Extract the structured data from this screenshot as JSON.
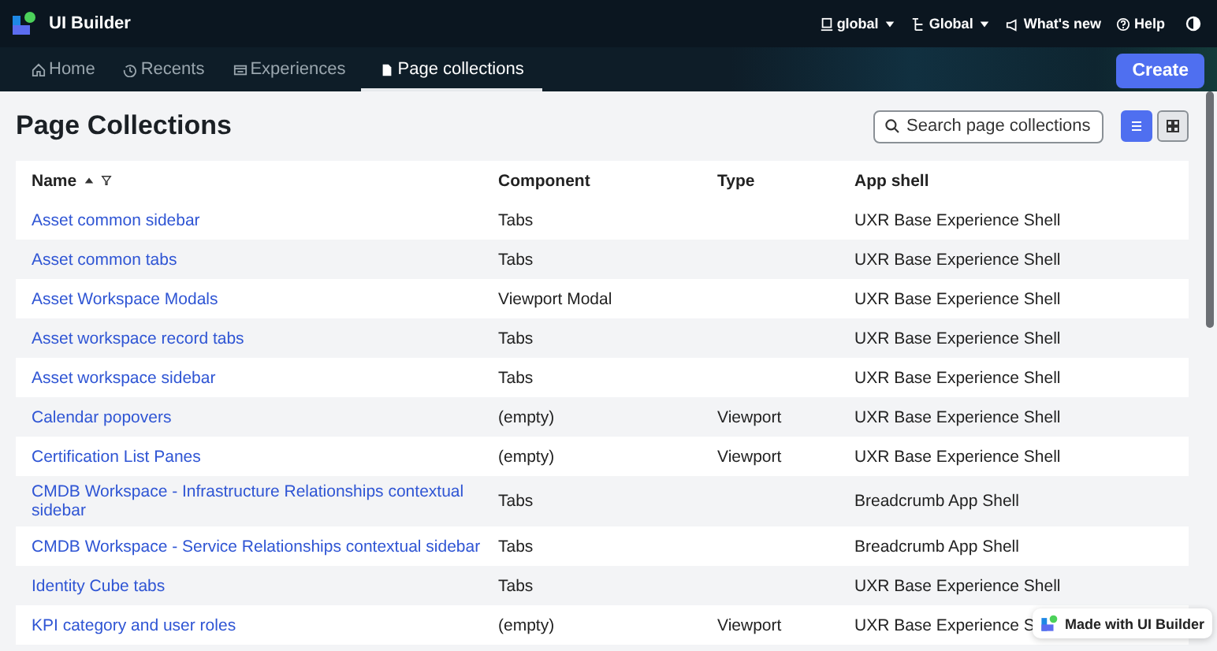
{
  "app": {
    "title": "UI Builder",
    "menus": [
      {
        "kind": "instance",
        "label": "global"
      },
      {
        "kind": "scope",
        "label": "Global"
      }
    ],
    "links": [
      {
        "kind": "news",
        "label": "What's new"
      },
      {
        "kind": "help",
        "label": "Help"
      }
    ]
  },
  "tabs": [
    {
      "kind": "home",
      "label": "Home",
      "selected": false
    },
    {
      "kind": "recents",
      "label": "Recents",
      "selected": false
    },
    {
      "kind": "experiences",
      "label": "Experiences",
      "selected": false
    },
    {
      "kind": "collections",
      "label": "Page collections",
      "selected": true
    }
  ],
  "create_button": "Create",
  "page": {
    "title": "Page Collections",
    "search": {
      "placeholder": "Search page collections"
    },
    "views": [
      {
        "kind": "list",
        "selected": true
      },
      {
        "kind": "grid",
        "selected": false
      }
    ]
  },
  "table": {
    "columns": [
      "Name",
      "Component",
      "Type",
      "App shell"
    ],
    "rows": [
      {
        "name": "Asset common sidebar",
        "component": "Tabs",
        "type": "",
        "app_shell": "UXR Base Experience Shell"
      },
      {
        "name": "Asset common tabs",
        "component": "Tabs",
        "type": "",
        "app_shell": "UXR Base Experience Shell"
      },
      {
        "name": "Asset Workspace Modals",
        "component": "Viewport Modal",
        "type": "",
        "app_shell": "UXR Base Experience Shell"
      },
      {
        "name": "Asset workspace record tabs",
        "component": "Tabs",
        "type": "",
        "app_shell": "UXR Base Experience Shell"
      },
      {
        "name": "Asset workspace sidebar",
        "component": "Tabs",
        "type": "",
        "app_shell": "UXR Base Experience Shell"
      },
      {
        "name": "Calendar popovers",
        "component": "(empty)",
        "type": "Viewport",
        "app_shell": "UXR Base Experience Shell"
      },
      {
        "name": "Certification List Panes",
        "component": "(empty)",
        "type": "Viewport",
        "app_shell": "UXR Base Experience Shell"
      },
      {
        "name": "CMDB Workspace - Infrastructure Relationships contextual sidebar",
        "component": "Tabs",
        "type": "",
        "app_shell": "Breadcrumb App Shell"
      },
      {
        "name": "CMDB Workspace - Service Relationships contextual sidebar",
        "component": "Tabs",
        "type": "",
        "app_shell": "Breadcrumb App Shell"
      },
      {
        "name": "Identity Cube tabs",
        "component": "Tabs",
        "type": "",
        "app_shell": "UXR Base Experience Shell"
      },
      {
        "name": "KPI category and user roles",
        "component": "(empty)",
        "type": "Viewport",
        "app_shell": "UXR Base Experience S"
      }
    ]
  },
  "badge": "Made with UI Builder"
}
